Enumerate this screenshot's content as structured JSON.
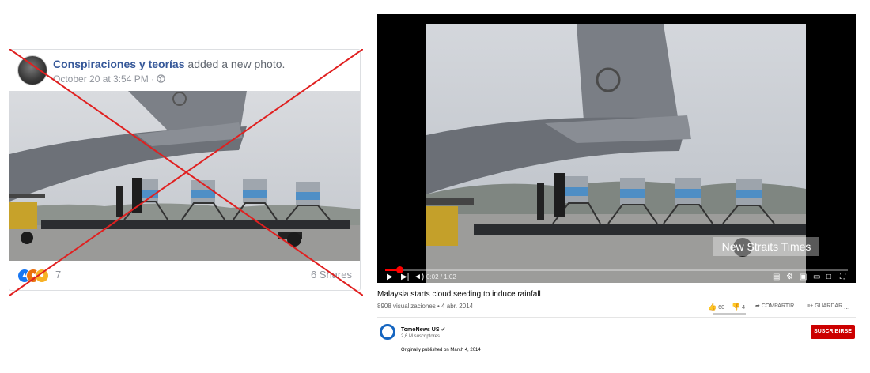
{
  "facebook_post": {
    "page_name": "Conspiraciones y teorías",
    "action_text": "added a new photo.",
    "timestamp": "October 20 at 3:54 PM ·",
    "audience_icon": "globe-icon",
    "reactions": [
      "like",
      "angry",
      "sad"
    ],
    "reaction_count": "7",
    "shares": "6 Shares"
  },
  "youtube": {
    "watermark": "New Straits Times",
    "time": "0:02 / 1:02",
    "progress_fraction": 0.03,
    "video_title": "Malaysia starts cloud seeding to induce rainfall",
    "meta": "8908 visualizaciones • 4 abr. 2014",
    "likes": "60",
    "dislikes": "4",
    "share_label": "COMPARTIR",
    "save_label": "GUARDAR",
    "more_label": "...",
    "channel_name": "TomoNews US",
    "subscribers": "2,6 M suscriptores",
    "subscribe_label": "SUSCRIBIRSE",
    "description": "Originally published on March 4, 2014"
  },
  "colors": {
    "facebook_link": "#365899",
    "youtube_red": "#cc0000",
    "cross_red": "#e02020"
  }
}
